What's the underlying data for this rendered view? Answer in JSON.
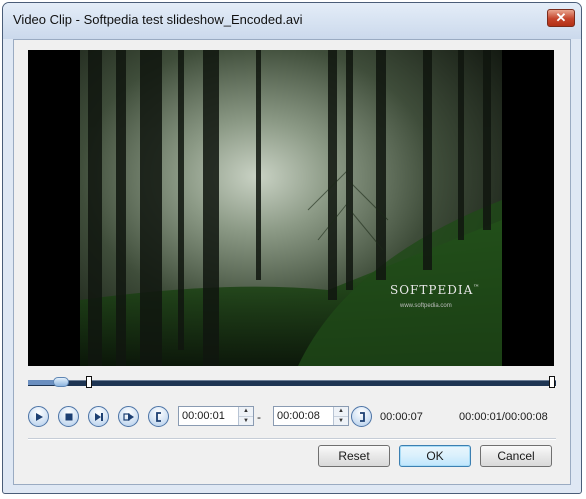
{
  "window": {
    "title": "Video Clip - Softpedia test slideshow_Encoded.avi",
    "close_glyph": "✕"
  },
  "video": {
    "watermark_title": "SOFTPEDIA",
    "watermark_symbol": "™",
    "watermark_url": "www.softpedia.com",
    "playback_position": 0.055,
    "trim_start": 0.11,
    "trim_end": 1.0
  },
  "controls": {
    "buttons": [
      {
        "name": "play-button",
        "icon": "play-icon"
      },
      {
        "name": "stop-button",
        "icon": "stop-icon"
      },
      {
        "name": "next-frame-button",
        "icon": "skip-forward-icon"
      },
      {
        "name": "export-button",
        "icon": "forward-frame-icon"
      },
      {
        "name": "set-start-button",
        "icon": "bracket-left-icon"
      },
      {
        "name": "set-end-button",
        "icon": "bracket-right-icon"
      }
    ],
    "start_time": "00:00:01",
    "dash": "-",
    "end_time": "00:00:08",
    "duration": "00:00:07",
    "position_readout": "00:00:01/00:00:08"
  },
  "footer": {
    "reset_label": "Reset",
    "ok_label": "OK",
    "cancel_label": "Cancel"
  },
  "colors": {
    "accent": "#4d74a6",
    "track": "#1e3553",
    "close": "#c5442b"
  }
}
